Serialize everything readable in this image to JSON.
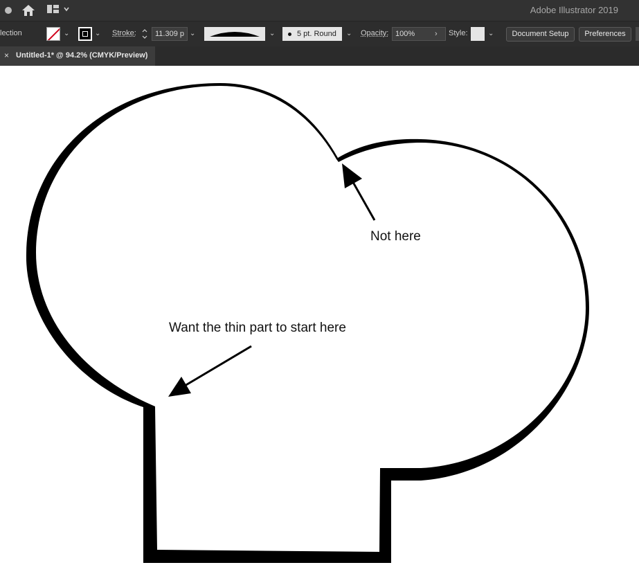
{
  "app": {
    "name": "Adobe Illustrator 2019"
  },
  "menu": {
    "workspace_icon": "workspace-switcher-icon"
  },
  "control_bar": {
    "selection_label": "lection",
    "stroke_label": "Stroke:",
    "stroke_weight": "11.309 p",
    "brush_label": "5 pt. Round",
    "opacity_label": "Opacity:",
    "opacity_value": "100%",
    "style_label": "Style:",
    "document_setup": "Document Setup",
    "preferences": "Preferences"
  },
  "document_tab": {
    "close": "×",
    "title": "Untitled-1* @ 94.2% (CMYK/Preview)"
  },
  "canvas": {
    "annotations": {
      "not_here": "Not here",
      "thin_part": "Want the thin part to start here"
    }
  },
  "colors": {
    "ui_dark": "#323232",
    "fill_none_slash": "#d0021b",
    "stroke": "#000000"
  }
}
